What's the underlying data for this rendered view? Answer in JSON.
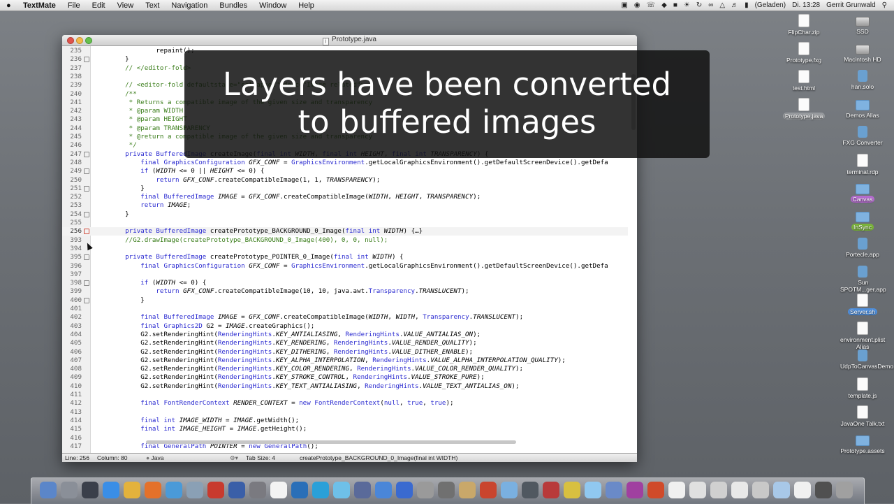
{
  "menubar": {
    "apple_glyph": "",
    "app_name": "TextMate",
    "items": [
      "File",
      "Edit",
      "View",
      "Text",
      "Navigation",
      "Bundles",
      "Window",
      "Help"
    ],
    "battery_status": "(Geladen)",
    "clock": "Di. 13:28",
    "user": "Gerrit Grunwald"
  },
  "window": {
    "title": "Prototype.java",
    "lines": [
      {
        "n": "235",
        "code": "            repaint();"
      },
      {
        "n": "236",
        "code": "    }",
        "fold": true
      },
      {
        "n": "237",
        "code": "    // </editor-fold>"
      },
      {
        "n": "238",
        "code": ""
      },
      {
        "n": "239",
        "code": "    // <editor-fold defaultstate=\"collapsed\" desc=\"Image related\">"
      },
      {
        "n": "240",
        "code": "    /**"
      },
      {
        "n": "241",
        "code": "     * Returns a compatible image of the given size and transparency"
      },
      {
        "n": "242",
        "code": "     * @param WIDTH"
      },
      {
        "n": "243",
        "code": "     * @param HEIGHT"
      },
      {
        "n": "244",
        "code": "     * @param TRANSPARENCY"
      },
      {
        "n": "245",
        "code": "     * @return a compatible image of the given size and transparency"
      },
      {
        "n": "246",
        "code": "     */"
      },
      {
        "n": "247",
        "code": "    private BufferedImage createImage(final int WIDTH, final int HEIGHT, final int TRANSPARENCY) {",
        "fold": true
      },
      {
        "n": "248",
        "code": "        final GraphicsConfiguration GFX_CONF = GraphicsEnvironment.getLocalGraphicsEnvironment().getDefaultScreenDevice().getDefa"
      },
      {
        "n": "249",
        "code": "        if (WIDTH <= 0 || HEIGHT <= 0) {",
        "fold": true
      },
      {
        "n": "250",
        "code": "            return GFX_CONF.createCompatibleImage(1, 1, TRANSPARENCY);"
      },
      {
        "n": "251",
        "code": "        }",
        "fold": true
      },
      {
        "n": "252",
        "code": "        final BufferedImage IMAGE = GFX_CONF.createCompatibleImage(WIDTH, HEIGHT, TRANSPARENCY);"
      },
      {
        "n": "253",
        "code": "        return IMAGE;"
      },
      {
        "n": "254",
        "code": "    }",
        "fold": true
      },
      {
        "n": "255",
        "code": ""
      },
      {
        "n": "256",
        "code": "    private BufferedImage createPrototype_BACKGROUND_0_Image(final int WIDTH) {…}",
        "fold": true,
        "hl": true
      },
      {
        "n": "393",
        "code": "    //G2.drawImage(createPrototype_BACKGROUND_0_Image(400), 0, 0, null);"
      },
      {
        "n": "394",
        "code": ""
      },
      {
        "n": "395",
        "code": "    private BufferedImage createPrototype_POINTER_0_Image(final int WIDTH) {",
        "fold": true
      },
      {
        "n": "396",
        "code": "        final GraphicsConfiguration GFX_CONF = GraphicsEnvironment.getLocalGraphicsEnvironment().getDefaultScreenDevice().getDefa"
      },
      {
        "n": "397",
        "code": ""
      },
      {
        "n": "398",
        "code": "        if (WIDTH <= 0) {",
        "fold": true
      },
      {
        "n": "399",
        "code": "            return GFX_CONF.createCompatibleImage(10, 10, java.awt.Transparency.TRANSLUCENT);"
      },
      {
        "n": "400",
        "code": "        }",
        "fold": true
      },
      {
        "n": "401",
        "code": ""
      },
      {
        "n": "402",
        "code": "        final BufferedImage IMAGE = GFX_CONF.createCompatibleImage(WIDTH, WIDTH, Transparency.TRANSLUCENT);"
      },
      {
        "n": "403",
        "code": "        final Graphics2D G2 = IMAGE.createGraphics();"
      },
      {
        "n": "404",
        "code": "        G2.setRenderingHint(RenderingHints.KEY_ANTIALIASING, RenderingHints.VALUE_ANTIALIAS_ON);"
      },
      {
        "n": "405",
        "code": "        G2.setRenderingHint(RenderingHints.KEY_RENDERING, RenderingHints.VALUE_RENDER_QUALITY);"
      },
      {
        "n": "406",
        "code": "        G2.setRenderingHint(RenderingHints.KEY_DITHERING, RenderingHints.VALUE_DITHER_ENABLE);"
      },
      {
        "n": "407",
        "code": "        G2.setRenderingHint(RenderingHints.KEY_ALPHA_INTERPOLATION, RenderingHints.VALUE_ALPHA_INTERPOLATION_QUALITY);"
      },
      {
        "n": "408",
        "code": "        G2.setRenderingHint(RenderingHints.KEY_COLOR_RENDERING, RenderingHints.VALUE_COLOR_RENDER_QUALITY);"
      },
      {
        "n": "409",
        "code": "        G2.setRenderingHint(RenderingHints.KEY_STROKE_CONTROL, RenderingHints.VALUE_STROKE_PURE);"
      },
      {
        "n": "410",
        "code": "        G2.setRenderingHint(RenderingHints.KEY_TEXT_ANTIALIASING, RenderingHints.VALUE_TEXT_ANTIALIAS_ON);"
      },
      {
        "n": "411",
        "code": ""
      },
      {
        "n": "412",
        "code": "        final FontRenderContext RENDER_CONTEXT = new FontRenderContext(null, true, true);"
      },
      {
        "n": "413",
        "code": ""
      },
      {
        "n": "414",
        "code": "        final int IMAGE_WIDTH = IMAGE.getWidth();"
      },
      {
        "n": "415",
        "code": "        final int IMAGE_HEIGHT = IMAGE.getHeight();"
      },
      {
        "n": "416",
        "code": ""
      },
      {
        "n": "417",
        "code": "        final GeneralPath POINTER = new GeneralPath();"
      }
    ],
    "status": {
      "line": "Line: 256",
      "column": "Column: 80",
      "language": "Java",
      "tab_size": "Tab Size:   4",
      "symbol": "createPrototype_BACKGROUND_0_Image(final int WIDTH)"
    }
  },
  "overlay": {
    "line1": "Layers have been converted",
    "line2": "to buffered images"
  },
  "desktop_icons": [
    {
      "label": "FlipChar.zip",
      "kind": "doc"
    },
    {
      "label": "SSD",
      "kind": "drive"
    },
    {
      "label": "Prototype.fxg",
      "kind": "doc"
    },
    {
      "label": "Macintosh HD",
      "kind": "drive"
    },
    {
      "label": "test.html",
      "kind": "doc"
    },
    {
      "label": "han.solo",
      "kind": "app"
    },
    {
      "label": "Prototype.java",
      "kind": "doc",
      "tag": "sel"
    },
    {
      "label": "Demos Alias",
      "kind": "folder"
    },
    {
      "label": "FXG Converter",
      "kind": "app"
    },
    {
      "label": "terminal.rdp",
      "kind": "doc"
    },
    {
      "label": "Canvas",
      "kind": "folder",
      "tag": "purple"
    },
    {
      "label": "InSync",
      "kind": "folder",
      "tag": "green"
    },
    {
      "label": "Portecle.app",
      "kind": "app"
    },
    {
      "label": "Sun SPOTM...ger.app",
      "kind": "app"
    },
    {
      "label": "Server.sh",
      "kind": "doc",
      "tag": "blue"
    },
    {
      "label": "environment.plist Alias",
      "kind": "doc"
    },
    {
      "label": "UdpToCanvasDemo.app",
      "kind": "app"
    },
    {
      "label": "template.js",
      "kind": "doc"
    },
    {
      "label": "JavaOne Talk.txt",
      "kind": "doc"
    },
    {
      "label": "Prototype.assets",
      "kind": "folder"
    }
  ],
  "dock_icons": [
    "finder-icon",
    "launchpad-icon",
    "mission-control-icon",
    "app-store-icon",
    "chrome-icon",
    "firefox-icon",
    "safari-icon",
    "preview-icon",
    "dice-icon",
    "stamps-icon",
    "system-preferences-icon",
    "calendar-icon",
    "network-icon",
    "skype-icon",
    "photos-icon",
    "keynote-icon",
    "itunes-icon",
    "xcode-icon",
    "gear-icon",
    "tools-icon",
    "box-icon",
    "3d-icon",
    "fx-icon",
    "vm-icon",
    "crossover-icon",
    "fireworks-icon",
    "cube-icon",
    "app-icon",
    "slides-icon",
    "java-icon",
    "pen-icon",
    "headphones-icon",
    "bird-icon",
    "wrench-icon",
    "download-icon",
    "box3d-icon",
    "grid-icon",
    "display-icon",
    "trash-icon"
  ],
  "colors": {
    "keyword": "#2a2ad0",
    "comment": "#3a7d1a",
    "overlay_bg": "#121212"
  }
}
